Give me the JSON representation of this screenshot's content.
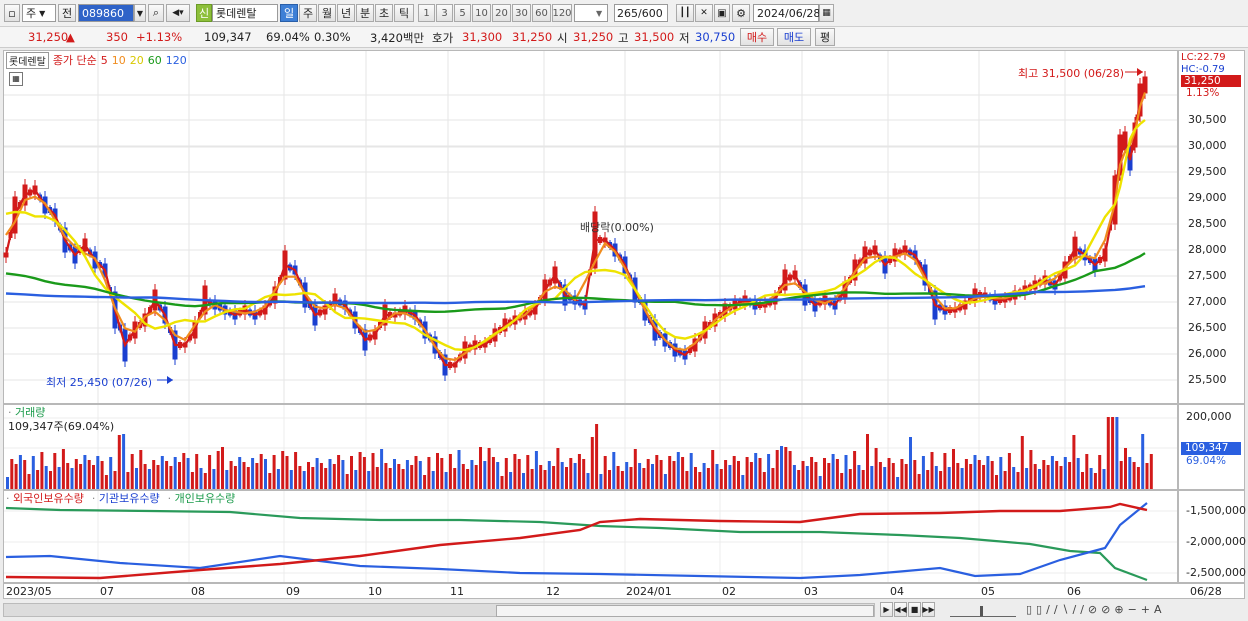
{
  "toolbar": {
    "period_main": "주",
    "search_type": "전",
    "stock_code": "089860",
    "credit_badge": "신",
    "stock_name": "롯데렌탈",
    "period_tabs": [
      {
        "label": "일",
        "selected": true
      },
      {
        "label": "주",
        "selected": false
      },
      {
        "label": "월",
        "selected": false
      },
      {
        "label": "년",
        "selected": false
      },
      {
        "label": "분",
        "selected": false
      },
      {
        "label": "초",
        "selected": false
      },
      {
        "label": "틱",
        "selected": false
      }
    ],
    "interval_buttons": [
      "1",
      "3",
      "5",
      "10",
      "20",
      "30",
      "60",
      "120"
    ],
    "count_current": "265",
    "count_total": "/600",
    "date": "2024/06/28"
  },
  "info": {
    "price": "31,250",
    "change_arrow": "▲",
    "change": "350",
    "change_pct": "+1.13%",
    "volume": "109,347",
    "volume_ratio": "69.04%",
    "turnover": "0.30%",
    "amount": "3,420백만",
    "ask_label": "호가",
    "ask1": "31,300",
    "ask2": "31,250",
    "open_label": "시",
    "open": "31,250",
    "high_label": "고",
    "high": "31,500",
    "low_label": "저",
    "low": "30,750",
    "buy_button": "매수",
    "sell_button": "매도",
    "eval_button": "평"
  },
  "price_panel": {
    "legend_name": "롯데렌탈",
    "legend_ma_label": "종가 단순",
    "ma_periods": [
      "5",
      "10",
      "20",
      "60",
      "120"
    ],
    "ma_colors": [
      "#d21a1a",
      "#f08c1e",
      "#e8e000",
      "#1a9a1a",
      "#2a5fe0"
    ],
    "max_label": "최고 31,500 (06/28)",
    "min_label": "최저 25,450 (07/26)",
    "event_label": "배당락(0.00%)",
    "lc_label": "LC:22.79",
    "hc_label": "HC:-0.79",
    "current_tag": "31,250",
    "current_pct": "1.13%",
    "y_labels": [
      "30,500",
      "30,000",
      "29,500",
      "29,000",
      "28,500",
      "28,000",
      "27,500",
      "27,000",
      "26,500",
      "26,000",
      "25,500"
    ]
  },
  "volume_panel": {
    "title": "거래량",
    "value_text": "109,347주(69.04%)",
    "y_labels": [
      "200,000"
    ],
    "current_tag": "109,347",
    "current_pct": "69.04%"
  },
  "holder_panel": {
    "legend": [
      "외국인보유수량",
      "기관보유수량",
      "개인보유수량"
    ],
    "legend_colors": [
      "#d21a1a",
      "#1a3fd0",
      "#1a9a4a"
    ],
    "y_labels": [
      "-1,500,000",
      "-2,000,000",
      "-2,500,000"
    ]
  },
  "x_labels": [
    "2023/05",
    "07",
    "08",
    "09",
    "10",
    "11",
    "12",
    "2024/01",
    "02",
    "03",
    "04",
    "05",
    "06",
    "06/28"
  ]
}
